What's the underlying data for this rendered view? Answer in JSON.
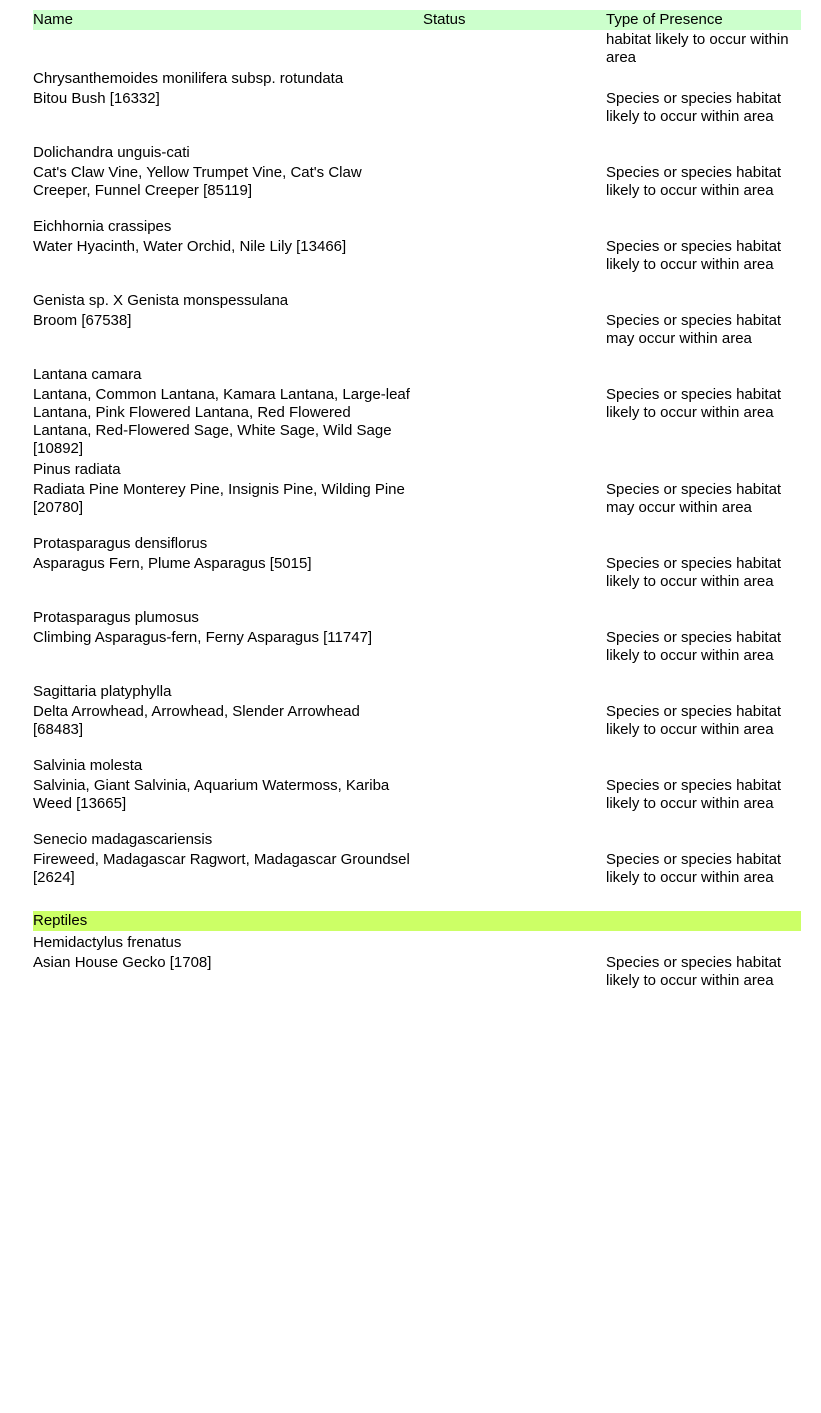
{
  "header": {
    "name": "Name",
    "status": "Status",
    "presence": "Type of Presence"
  },
  "continuation": {
    "presence": "habitat likely to occur within area"
  },
  "entries": [
    {
      "scientific": "Chrysanthemoides monilifera subsp. rotundata",
      "common": "Bitou Bush [16332]",
      "status": "",
      "presence": "Species or species habitat likely to occur within area"
    },
    {
      "scientific": "Dolichandra unguis-cati",
      "common": "Cat's Claw Vine, Yellow Trumpet Vine, Cat's Claw Creeper, Funnel Creeper [85119]",
      "status": "",
      "presence": "Species or species habitat likely to occur within area"
    },
    {
      "scientific": "Eichhornia crassipes",
      "common": "Water Hyacinth, Water Orchid, Nile Lily [13466]",
      "status": "",
      "presence": "Species or species habitat likely to occur within area"
    },
    {
      "scientific": "Genista sp. X Genista monspessulana",
      "common": "Broom [67538]",
      "status": "",
      "presence": "Species or species habitat may occur within area"
    },
    {
      "scientific": "Lantana camara",
      "common": "Lantana, Common Lantana, Kamara Lantana, Large-leaf Lantana, Pink Flowered Lantana, Red Flowered Lantana, Red-Flowered Sage, White Sage, Wild Sage [10892]",
      "status": "",
      "presence": "Species or species habitat likely to occur within area"
    },
    {
      "scientific": "Pinus radiata",
      "common": "Radiata Pine Monterey Pine, Insignis Pine, Wilding Pine [20780]",
      "status": "",
      "presence": "Species or species habitat may occur within area"
    },
    {
      "scientific": "Protasparagus densiflorus",
      "common": "Asparagus Fern, Plume Asparagus [5015]",
      "status": "",
      "presence": "Species or species habitat likely to occur within area"
    },
    {
      "scientific": "Protasparagus plumosus",
      "common": "Climbing Asparagus-fern, Ferny Asparagus [11747]",
      "status": "",
      "presence": "Species or species habitat likely to occur within area"
    },
    {
      "scientific": "Sagittaria platyphylla",
      "common": "Delta Arrowhead, Arrowhead, Slender Arrowhead [68483]",
      "status": "",
      "presence": "Species or species habitat likely to occur within area"
    },
    {
      "scientific": "Salvinia molesta",
      "common": "Salvinia, Giant Salvinia, Aquarium Watermoss, Kariba Weed [13665]",
      "status": "",
      "presence": "Species or species habitat likely to occur within area"
    },
    {
      "scientific": "Senecio madagascariensis",
      "common": "Fireweed, Madagascar Ragwort, Madagascar Groundsel [2624]",
      "status": "",
      "presence": "Species or species habitat likely to occur within area"
    }
  ],
  "group": {
    "label": "Reptiles"
  },
  "group_entries": [
    {
      "scientific": "Hemidactylus frenatus",
      "common": "Asian House Gecko [1708]",
      "status": "",
      "presence": "Species or species habitat likely to occur within area"
    }
  ]
}
